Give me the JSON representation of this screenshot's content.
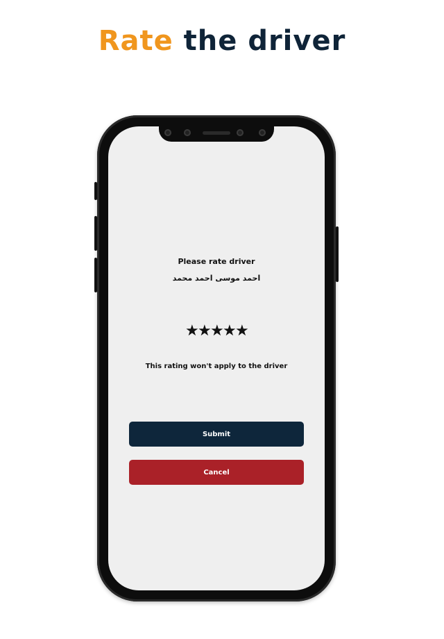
{
  "headline": {
    "accent_word": "Rate",
    "rest": " the driver"
  },
  "screen": {
    "prompt": "Please rate driver",
    "driver_name": "احمد موسى احمد محمد",
    "rating": {
      "value": 5,
      "max": 5,
      "star_glyph": "★"
    },
    "note": "This rating won't apply to the driver",
    "submit_label": "Submit",
    "cancel_label": "Cancel"
  },
  "colors": {
    "accent": "#f0961e",
    "navy": "#0e263b",
    "cancel_red": "#aa2128",
    "screen_bg": "#efefef"
  }
}
